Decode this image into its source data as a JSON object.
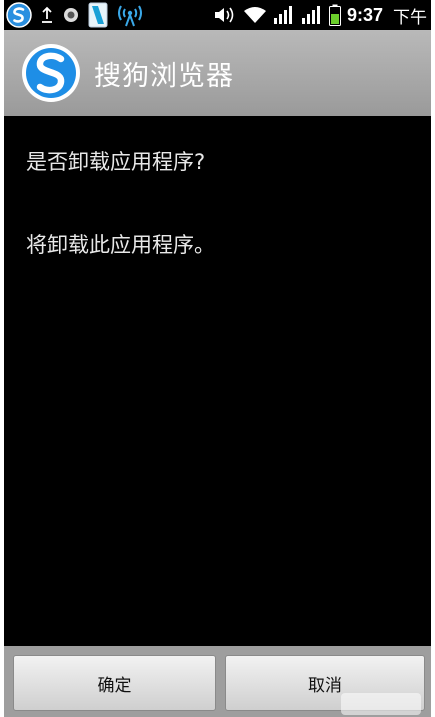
{
  "status_bar": {
    "icons": [
      "sogou-notification-icon",
      "upload-icon",
      "record-icon",
      "phone-icon",
      "hotspot-icon",
      "volume-icon",
      "wifi-icon",
      "signal-icon",
      "signal-icon-2",
      "battery-icon"
    ],
    "time": "9:37",
    "ampm": "下午"
  },
  "title_bar": {
    "app_name": "搜狗浏览器",
    "icon": "sogou-browser-icon"
  },
  "dialog": {
    "question": "是否卸载应用程序?",
    "message": "将卸载此应用程序。"
  },
  "buttons": {
    "ok_label": "确定",
    "cancel_label": "取消"
  },
  "colors": {
    "background": "#000000",
    "title_bar": "#a8a8a8",
    "accent_blue": "#1e8ee6"
  }
}
